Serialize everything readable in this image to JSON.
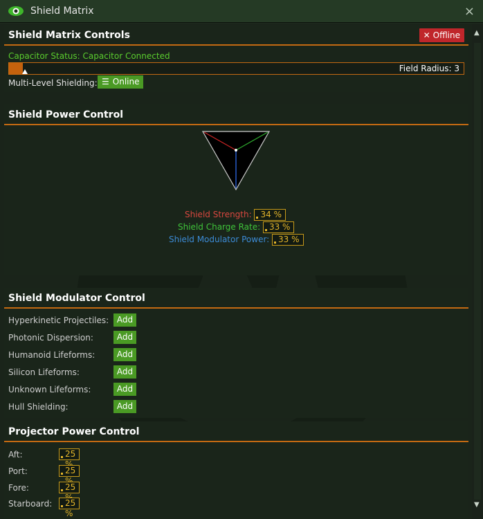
{
  "window": {
    "title": "Shield Matrix",
    "close_label": "×"
  },
  "controls": {
    "header": "Shield Matrix Controls",
    "offline_label": "Offline",
    "capacitor_status": "Capacitor Status: Capacitor Connected",
    "field_radius_label": "Field Radius: 3",
    "field_radius_fraction": 0.03,
    "multi_level_label": "Multi-Level Shielding:",
    "online_label": "Online"
  },
  "power": {
    "header": "Shield Power Control",
    "rows": [
      {
        "label": "Shield Strength:",
        "value": "34 %",
        "color": "#d8473f"
      },
      {
        "label": "Shield Charge Rate:",
        "value": "33 %",
        "color": "#3fc33a"
      },
      {
        "label": "Shield Modulator Power:",
        "value": "33 %",
        "color": "#3c8bd6"
      }
    ]
  },
  "modulator": {
    "header": "Shield Modulator Control",
    "add_label": "Add",
    "items": [
      "Hyperkinetic Projectiles:",
      "Photonic Dispersion:",
      "Humanoid Lifeforms:",
      "Silicon Lifeforms:",
      "Unknown Lifeforms:",
      "Hull Shielding:"
    ]
  },
  "projector": {
    "header": "Projector Power Control",
    "rows": [
      {
        "label": "Aft:",
        "value": "25 %"
      },
      {
        "label": "Port:",
        "value": "25 %"
      },
      {
        "label": "Fore:",
        "value": "25 %"
      },
      {
        "label": "Starboard:",
        "value": "25 %"
      }
    ]
  },
  "colors": {
    "accent": "#c46a12",
    "green_button": "#4a9a24",
    "red_button": "#c0262b"
  }
}
